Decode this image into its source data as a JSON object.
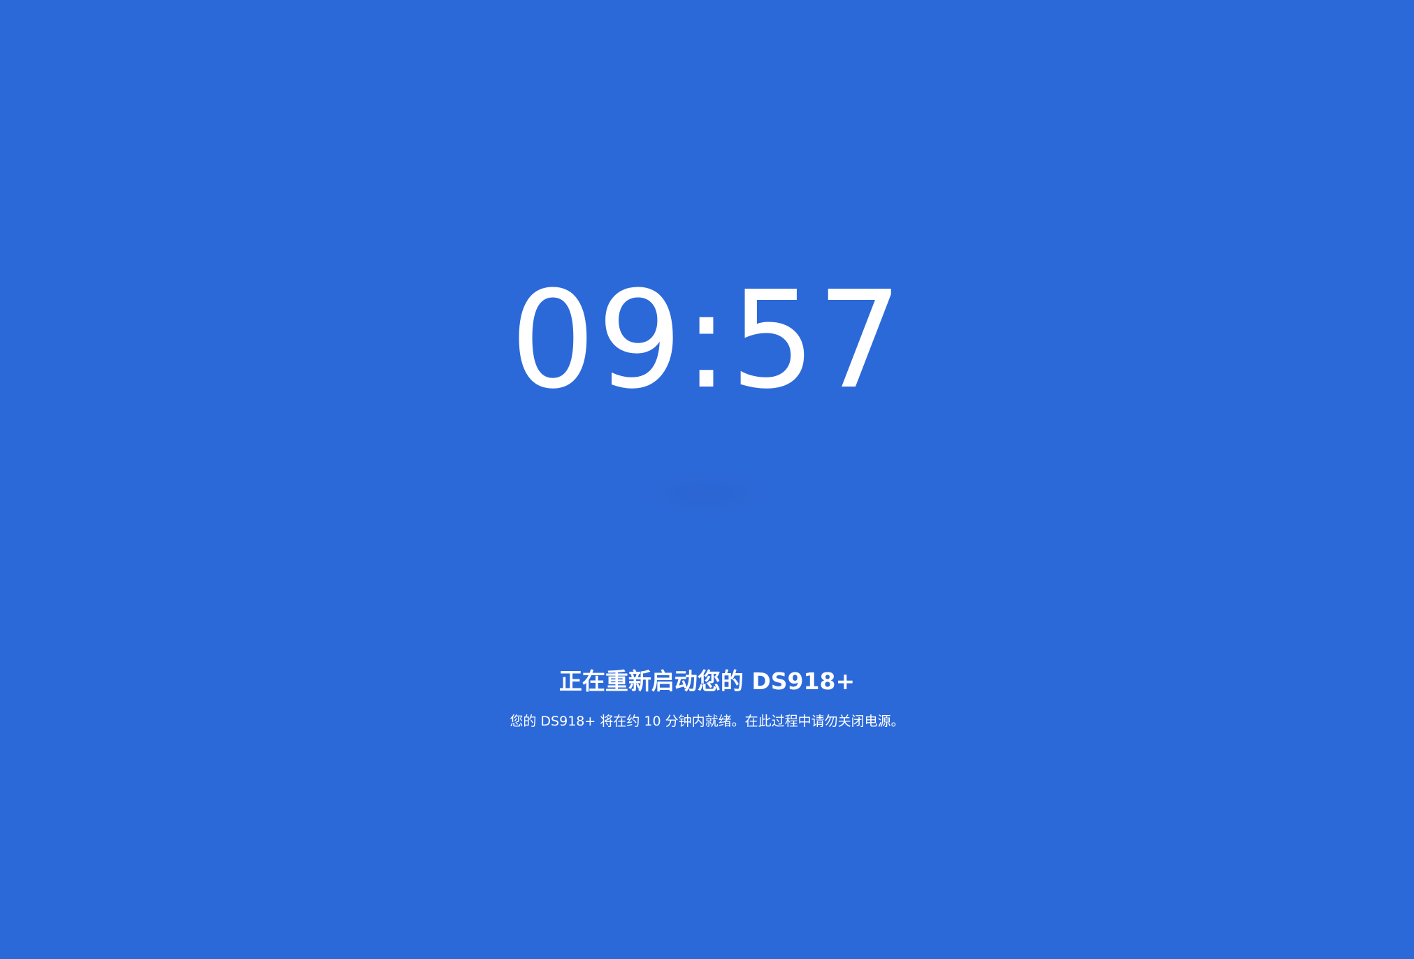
{
  "reboot": {
    "countdown": "09:57",
    "title": "正在重新启动您的 DS918+",
    "message": "您的 DS918+ 将在约 10 分钟内就绪。在此过程中请勿关闭电源。",
    "progress_remaining_minutes": 9.95
  },
  "colors": {
    "background": "#2c69d8",
    "text": "#ffffff"
  }
}
